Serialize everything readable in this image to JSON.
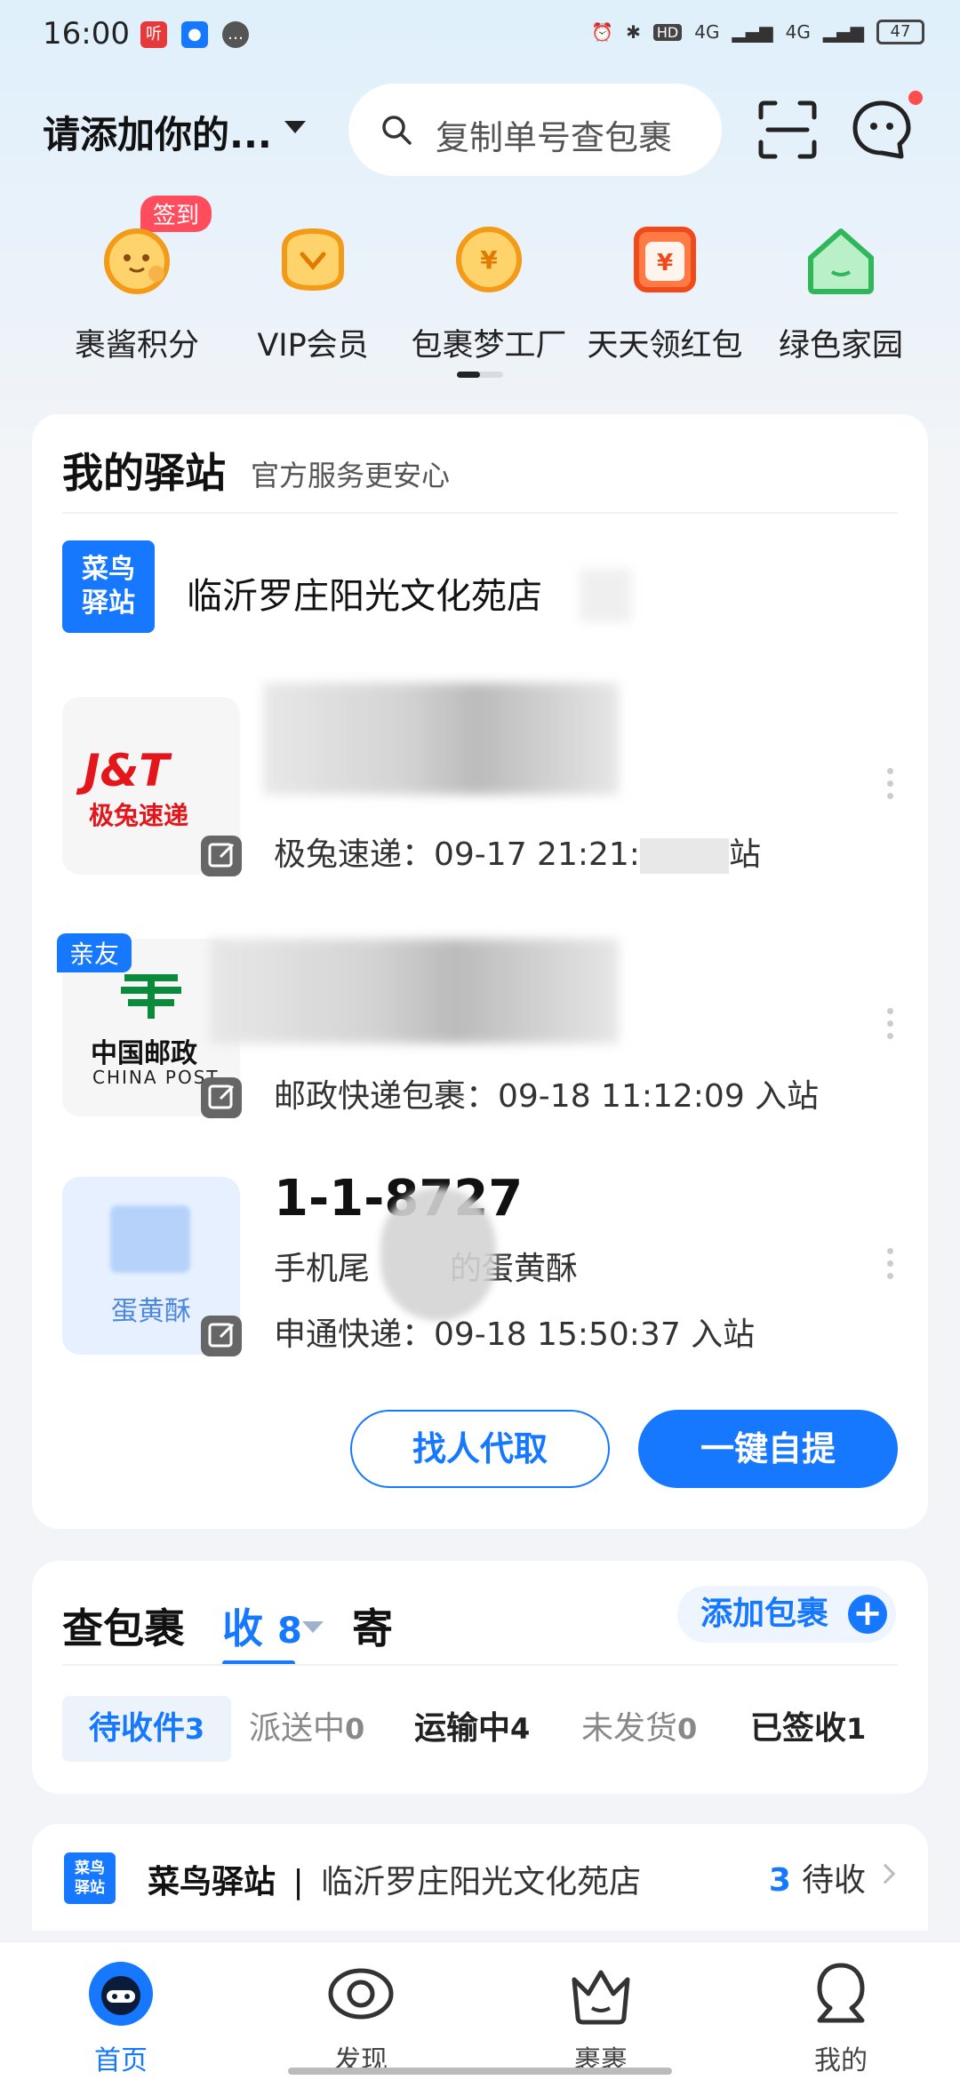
{
  "status_bar": {
    "time": "16:00",
    "network_1": "4G",
    "network_2": "4G",
    "battery": "47"
  },
  "header": {
    "location": "请添加你的...",
    "search_placeholder": "复制单号查包裹"
  },
  "quick_entries": {
    "signin_badge": "签到",
    "items": [
      {
        "label": "裹酱积分",
        "icon": "mascot-icon"
      },
      {
        "label": "VIP会员",
        "icon": "vip-icon"
      },
      {
        "label": "包裹梦工厂",
        "icon": "coin-icon"
      },
      {
        "label": "天天领红包",
        "icon": "red-packet-icon"
      },
      {
        "label": "绿色家园",
        "icon": "green-home-icon"
      }
    ]
  },
  "station_card": {
    "title": "我的驿站",
    "subtitle": "官方服务更安心",
    "logo_line1": "菜鸟",
    "logo_line2": "驿站",
    "station_name": "临沂罗庄阳光文化苑店",
    "packages": [
      {
        "logo_line1": "J&T",
        "logo_line2": "极兔速递",
        "info": "极兔速递：09-17 21:21:",
        "suffix": "站"
      },
      {
        "tag": "亲友",
        "logo_line1": "中国邮政",
        "logo_line2": "CHINA POST",
        "info": "邮政快递包裹：09-18 11:12:09 入站"
      },
      {
        "code": "1-1-8727",
        "thumb_label": "蛋黄酥",
        "desc_prefix": "手机尾",
        "desc_suffix": "的蛋黄酥",
        "info": "申通快递：09-18 15:50:37 入站"
      }
    ],
    "btn_proxy": "找人代取",
    "btn_pickup": "一键自提"
  },
  "package_query": {
    "title": "查包裹",
    "tab_receive": "收",
    "receive_count": "8",
    "tab_send": "寄",
    "add_button": "添加包裹",
    "statuses": [
      {
        "label": "待收件",
        "count": "3"
      },
      {
        "label": "派送中",
        "count": "0"
      },
      {
        "label": "运输中",
        "count": "4"
      },
      {
        "label": "未发货",
        "count": "0"
      },
      {
        "label": "已签收",
        "count": "1"
      }
    ]
  },
  "station_summary": {
    "logo_line1": "菜鸟",
    "logo_line2": "驿站",
    "brand": "菜鸟驿站",
    "separator": "|",
    "name": "临沂罗庄阳光文化苑店",
    "count": "3",
    "count_label": "待收"
  },
  "bottom_nav": [
    {
      "label": "首页",
      "active": true
    },
    {
      "label": "发现"
    },
    {
      "label": "裹裹"
    },
    {
      "label": "我的"
    }
  ],
  "colors": {
    "accent": "#1677ff",
    "badge": "#ff4d5e",
    "orange": "#f7a21b"
  }
}
